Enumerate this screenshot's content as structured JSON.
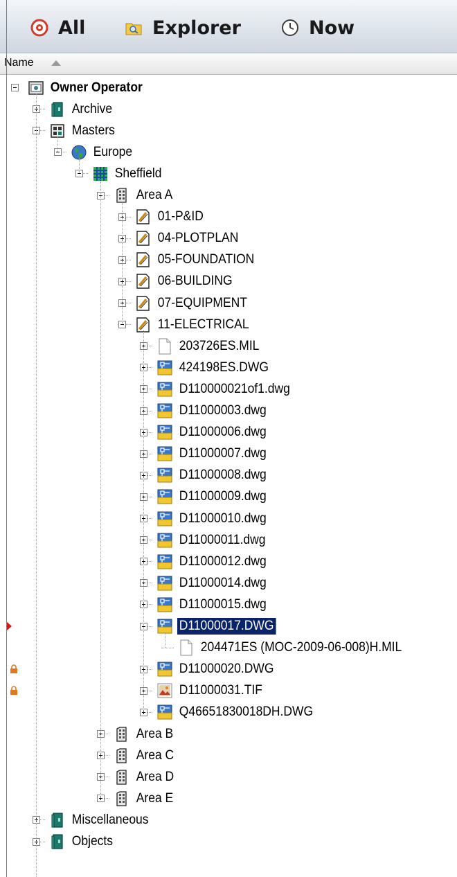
{
  "toolbar": {
    "all_label": "All",
    "explorer_label": "Explorer",
    "now_label": "Now"
  },
  "header": {
    "name_label": "Name"
  },
  "colors": {
    "selection": "#0a246a",
    "folder_teal": "#1b7a6c",
    "drawing_blue": "#3a78c8",
    "drawing_yellow": "#f2c62f",
    "lock_orange": "#e0781e",
    "marker_red": "#d01818"
  },
  "tree": [
    {
      "label": "Owner Operator",
      "depth": 0,
      "icon": "server-icon",
      "toggle": "minus",
      "bold": true
    },
    {
      "label": "Archive",
      "depth": 1,
      "icon": "teal-book-icon",
      "toggle": "plus"
    },
    {
      "label": "Masters",
      "depth": 1,
      "icon": "masters-icon",
      "toggle": "minus"
    },
    {
      "label": "Europe",
      "depth": 2,
      "icon": "globe-icon",
      "toggle": "minus"
    },
    {
      "label": "Sheffield",
      "depth": 3,
      "icon": "grid-icon",
      "toggle": "minus"
    },
    {
      "label": "Area A",
      "depth": 4,
      "icon": "building-icon",
      "toggle": "minus"
    },
    {
      "label": "01-P&ID",
      "depth": 5,
      "icon": "drawing-set-icon",
      "toggle": "plus"
    },
    {
      "label": "04-PLOTPLAN",
      "depth": 5,
      "icon": "drawing-set-icon",
      "toggle": "plus"
    },
    {
      "label": "05-FOUNDATION",
      "depth": 5,
      "icon": "drawing-set-icon",
      "toggle": "plus"
    },
    {
      "label": "06-BUILDING",
      "depth": 5,
      "icon": "drawing-set-icon",
      "toggle": "plus"
    },
    {
      "label": "07-EQUIPMENT",
      "depth": 5,
      "icon": "drawing-set-icon",
      "toggle": "plus"
    },
    {
      "label": "11-ELECTRICAL",
      "depth": 5,
      "icon": "drawing-set-icon",
      "toggle": "minus"
    },
    {
      "label": "203726ES.MIL",
      "depth": 6,
      "icon": "file-icon",
      "toggle": "plus"
    },
    {
      "label": "424198ES.DWG",
      "depth": 6,
      "icon": "dwg-icon",
      "toggle": "plus"
    },
    {
      "label": "D110000021of1.dwg",
      "depth": 6,
      "icon": "dwg-icon",
      "toggle": "plus"
    },
    {
      "label": "D11000003.dwg",
      "depth": 6,
      "icon": "dwg-icon",
      "toggle": "plus"
    },
    {
      "label": "D11000006.dwg",
      "depth": 6,
      "icon": "dwg-icon",
      "toggle": "plus"
    },
    {
      "label": "D11000007.dwg",
      "depth": 6,
      "icon": "dwg-icon",
      "toggle": "plus"
    },
    {
      "label": "D11000008.dwg",
      "depth": 6,
      "icon": "dwg-icon",
      "toggle": "plus"
    },
    {
      "label": "D11000009.dwg",
      "depth": 6,
      "icon": "dwg-icon",
      "toggle": "plus"
    },
    {
      "label": "D11000010.dwg",
      "depth": 6,
      "icon": "dwg-icon",
      "toggle": "plus"
    },
    {
      "label": "D11000011.dwg",
      "depth": 6,
      "icon": "dwg-icon",
      "toggle": "plus"
    },
    {
      "label": "D11000012.dwg",
      "depth": 6,
      "icon": "dwg-icon",
      "toggle": "plus"
    },
    {
      "label": "D11000014.dwg",
      "depth": 6,
      "icon": "dwg-icon",
      "toggle": "plus"
    },
    {
      "label": "D11000015.dwg",
      "depth": 6,
      "icon": "dwg-icon",
      "toggle": "plus"
    },
    {
      "label": "D11000017.DWG",
      "depth": 6,
      "icon": "dwg-icon",
      "toggle": "minus",
      "selected": true,
      "marker": "red-arrow"
    },
    {
      "label": "204471ES (MOC-2009-06-008)H.MIL",
      "depth": 7,
      "icon": "file-icon",
      "toggle": "none"
    },
    {
      "label": "D11000020.DWG",
      "depth": 6,
      "icon": "dwg-icon",
      "toggle": "plus",
      "marker": "lock"
    },
    {
      "label": "D11000031.TIF",
      "depth": 6,
      "icon": "tif-icon",
      "toggle": "plus",
      "marker": "lock"
    },
    {
      "label": "Q46651830018DH.DWG",
      "depth": 6,
      "icon": "dwg-icon",
      "toggle": "plus"
    },
    {
      "label": "Area B",
      "depth": 4,
      "icon": "building-icon",
      "toggle": "plus"
    },
    {
      "label": "Area C",
      "depth": 4,
      "icon": "building-icon",
      "toggle": "plus"
    },
    {
      "label": "Area D",
      "depth": 4,
      "icon": "building-icon",
      "toggle": "plus"
    },
    {
      "label": "Area E",
      "depth": 4,
      "icon": "building-icon",
      "toggle": "plus"
    },
    {
      "label": "Miscellaneous",
      "depth": 1,
      "icon": "teal-book-icon",
      "toggle": "plus"
    },
    {
      "label": "Objects",
      "depth": 1,
      "icon": "teal-book-icon",
      "toggle": "plus"
    }
  ]
}
